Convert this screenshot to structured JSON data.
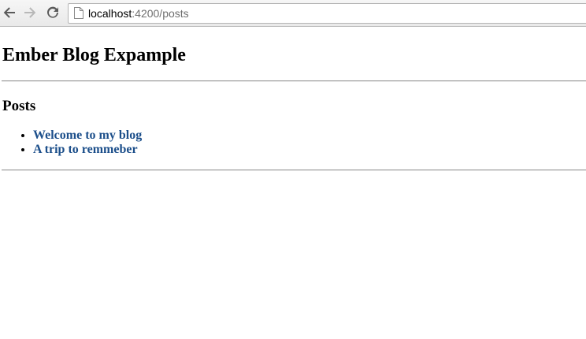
{
  "browser": {
    "back_icon": "arrow-left-icon",
    "forward_icon": "arrow-right-icon",
    "reload_icon": "reload-icon",
    "page_icon": "page-icon",
    "url_host": "localhost",
    "url_path": ":4200/posts"
  },
  "page": {
    "title": "Ember Blog Expample",
    "section_title": "Posts",
    "posts": [
      {
        "label": "Welcome to my blog"
      },
      {
        "label": "A trip to remmeber"
      }
    ]
  },
  "colors": {
    "link": "#1b4e8a",
    "rule": "#9b9b9b",
    "toolbar": "#efefef"
  }
}
